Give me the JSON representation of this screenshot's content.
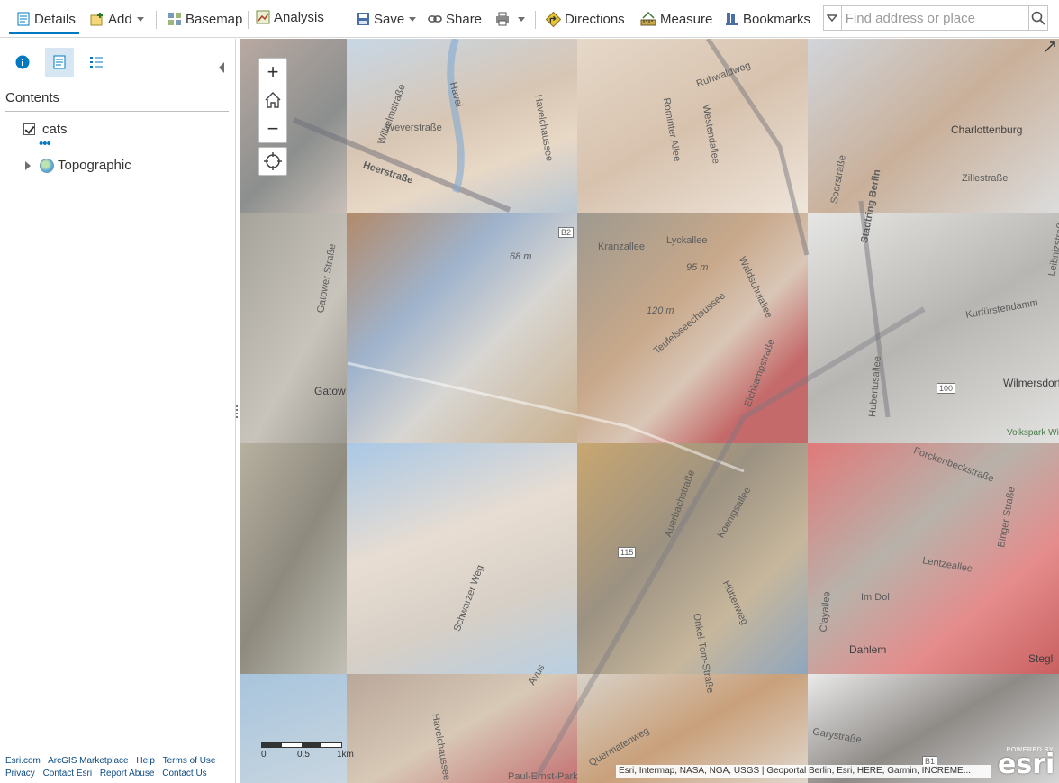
{
  "toolbar": {
    "details": "Details",
    "add": "Add",
    "basemap": "Basemap",
    "analysis": "Analysis",
    "save": "Save",
    "share": "Share",
    "directions": "Directions",
    "measure": "Measure",
    "bookmarks": "Bookmarks",
    "search_placeholder": "Find address or place"
  },
  "sidebar": {
    "contents_title": "Contents",
    "layers": [
      {
        "name": "cats",
        "checked": true
      },
      {
        "name": "Topographic",
        "type": "basemap"
      }
    ],
    "footer_links": [
      "Esri.com",
      "ArcGIS Marketplace",
      "Help",
      "Terms of Use",
      "Privacy",
      "Contact Esri",
      "Report Abuse",
      "Contact Us"
    ]
  },
  "map": {
    "road_labels": [
      "Wilhelmstraße",
      "Weverstraße",
      "Havel",
      "Heerstraße",
      "Havelchaussee",
      "Rominter Allee",
      "Westendallee",
      "Ruhwaldweg",
      "Charlottenburg",
      "Zillestraße",
      "Soorstraße",
      "Stadtring Berlin",
      "Gatower Straße",
      "Gatow",
      "68 m",
      "B2",
      "Kranzallee",
      "Lyckallee",
      "95 m",
      "120 m",
      "Teufelsseechaussee",
      "Waldschulallee",
      "Eichkampstraße",
      "Kurfürstendamm",
      "Hubertusallee",
      "100",
      "Wilmersdorf",
      "Leibnizstraße",
      "Volkspark Wilmersdorf",
      "Auerbachstraße",
      "Koenigsallee",
      "115",
      "Hüttenweg",
      "Onkel-Tom-Straße",
      "Schwarzer Weg",
      "Forckenbeckstraße",
      "Binger Straße",
      "Lentzeallee",
      "Im Dol",
      "Clayallee",
      "Dahlem",
      "Stegl",
      "Avus",
      "Quermatenweg",
      "Garystraße",
      "B1",
      "Paul-Ernst-Park",
      "Havelchaussee"
    ],
    "zoom_in": "+",
    "zoom_out": "−",
    "scale_labels": [
      "0",
      "0.5",
      "1km"
    ],
    "attribution": "Esri, Intermap, NASA, NGA, USGS | Geoportal Berlin, Esri, HERE, Garmin, INCREME...",
    "powered_by": "POWERED BY",
    "logo": "esri"
  },
  "colors": {
    "accent": "#0079c1",
    "active_tab": "#d7e6f3"
  }
}
